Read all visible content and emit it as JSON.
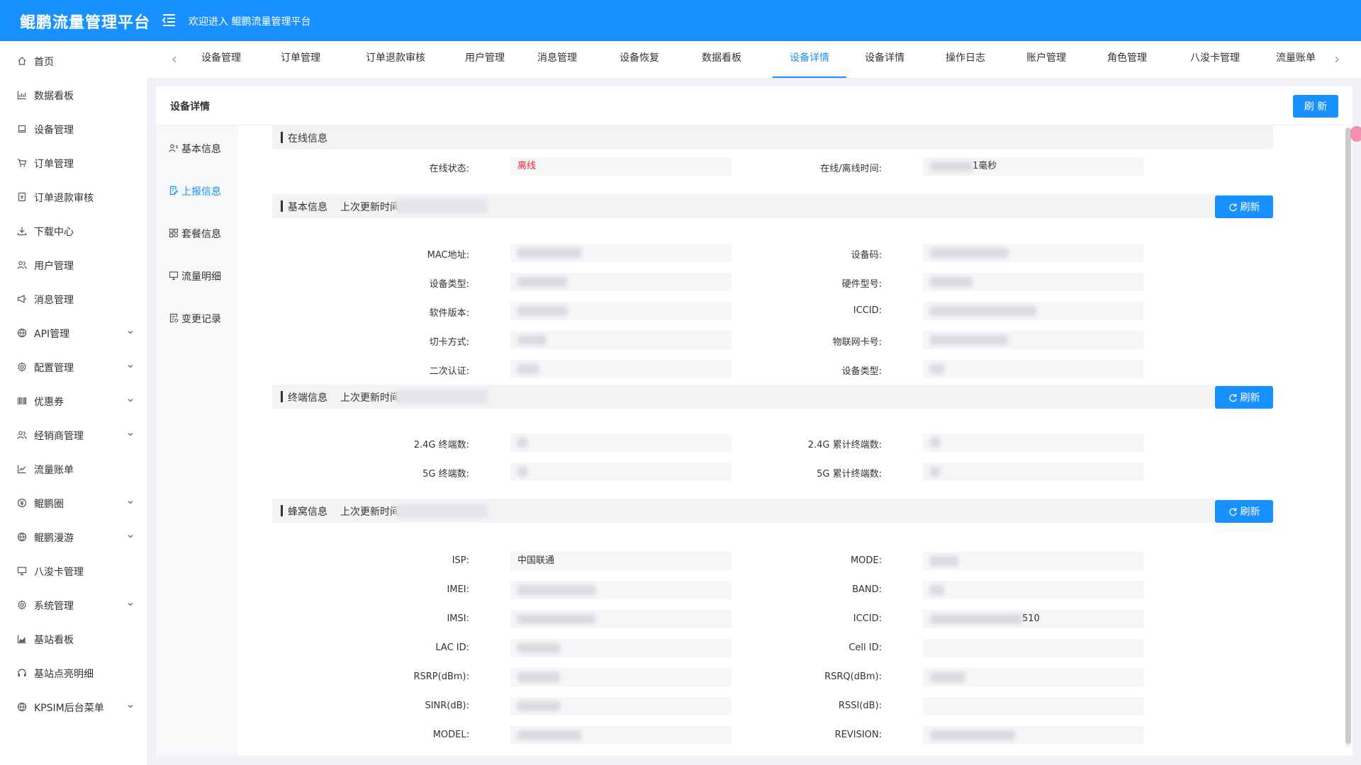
{
  "header": {
    "app_title": "鲲鹏流量管理平台",
    "welcome": "欢迎进入 鲲鹏流量管理平台"
  },
  "sidebar": {
    "items": [
      {
        "label": "首页",
        "icon": "home-icon",
        "expandable": false
      },
      {
        "label": "数据看板",
        "icon": "bar-chart-icon",
        "expandable": false
      },
      {
        "label": "设备管理",
        "icon": "laptop-icon",
        "expandable": false
      },
      {
        "label": "订单管理",
        "icon": "cart-icon",
        "expandable": false
      },
      {
        "label": "订单退款审核",
        "icon": "refund-icon",
        "expandable": false
      },
      {
        "label": "下载中心",
        "icon": "download-icon",
        "expandable": false
      },
      {
        "label": "用户管理",
        "icon": "users-icon",
        "expandable": false
      },
      {
        "label": "消息管理",
        "icon": "megaphone-icon",
        "expandable": false
      },
      {
        "label": "API管理",
        "icon": "globe-icon",
        "expandable": true
      },
      {
        "label": "配置管理",
        "icon": "gear-icon",
        "expandable": true
      },
      {
        "label": "优惠券",
        "icon": "barcode-icon",
        "expandable": true
      },
      {
        "label": "经销商管理",
        "icon": "users-icon",
        "expandable": true
      },
      {
        "label": "流量账单",
        "icon": "line-chart-icon",
        "expandable": false
      },
      {
        "label": "鲲鹏圈",
        "icon": "yen-icon",
        "expandable": true
      },
      {
        "label": "鲲鹏漫游",
        "icon": "globe-icon",
        "expandable": true
      },
      {
        "label": "八浚卡管理",
        "icon": "monitor-icon",
        "expandable": false
      },
      {
        "label": "系统管理",
        "icon": "gear-icon",
        "expandable": true
      },
      {
        "label": "基站看板",
        "icon": "area-chart-icon",
        "expandable": false
      },
      {
        "label": "基站点亮明细",
        "icon": "headset-icon",
        "expandable": false
      },
      {
        "label": "KPSIM后台菜单",
        "icon": "globe-icon",
        "expandable": true
      }
    ]
  },
  "tabs": {
    "items": [
      {
        "label": "设备管理",
        "active": false
      },
      {
        "label": "订单管理",
        "active": false
      },
      {
        "label": "订单退款审核",
        "active": false
      },
      {
        "label": "用户管理",
        "active": false
      },
      {
        "label": "消息管理",
        "active": false
      },
      {
        "label": "设备恢复",
        "active": false
      },
      {
        "label": "数据看板",
        "active": false
      },
      {
        "label": "设备详情",
        "active": true
      },
      {
        "label": "设备详情",
        "active": false
      },
      {
        "label": "操作日志",
        "active": false
      },
      {
        "label": "账户管理",
        "active": false
      },
      {
        "label": "角色管理",
        "active": false
      },
      {
        "label": "八浚卡管理",
        "active": false
      },
      {
        "label": "流量账单",
        "active": false
      }
    ]
  },
  "card": {
    "title": "设备详情",
    "refresh_label": "刷 新"
  },
  "subnav": {
    "items": [
      {
        "label": "基本信息",
        "icon": "user-group-icon",
        "active": false
      },
      {
        "label": "上报信息",
        "icon": "document-edit-icon",
        "active": true
      },
      {
        "label": "套餐信息",
        "icon": "grid-icon",
        "active": false
      },
      {
        "label": "流量明细",
        "icon": "monitor-icon",
        "active": false
      },
      {
        "label": "变更记录",
        "icon": "document-list-icon",
        "active": false
      }
    ]
  },
  "sections": {
    "online": {
      "title": "在线信息",
      "fields": {
        "status_label": "在线状态:",
        "status_value": "离线",
        "status_color": "#f5222d",
        "time_label": "在线/离线时间:",
        "time_value_tail": "1毫秒"
      }
    },
    "basic": {
      "title": "基本信息",
      "time_label": "上次更新时间:",
      "refresh_label": "刷新",
      "left_labels": [
        "MAC地址:",
        "设备类型:",
        "软件版本:",
        "切卡方式:",
        "二次认证:"
      ],
      "right_labels": [
        "设备码:",
        "硬件型号:",
        "ICCID:",
        "物联网卡号:",
        "设备类型:"
      ]
    },
    "terminal": {
      "title": "终端信息",
      "time_label": "上次更新时间:",
      "refresh_label": "刷新",
      "left_labels": [
        "2.4G 终端数:",
        "5G 终端数:"
      ],
      "right_labels": [
        "2.4G 累计终端数:",
        "5G 累计终端数:"
      ]
    },
    "cellular": {
      "title": "蜂窝信息",
      "time_label": "上次更新时间:",
      "refresh_label": "刷新",
      "left_labels": [
        "ISP:",
        "IMEI:",
        "IMSI:",
        "LAC ID:",
        "RSRP(dBm):",
        "SINR(dB):",
        "MODEL:"
      ],
      "right_labels": [
        "MODE:",
        "BAND:",
        "ICCID:",
        "Cell ID:",
        "RSRQ(dBm):",
        "RSSI(dB):",
        "REVISION:"
      ],
      "isp_value": "中国联通",
      "iccid_tail": "510"
    }
  },
  "colors": {
    "primary": "#1890ff",
    "offline_red": "#f5222d",
    "section_bg": "#f2f3f5"
  }
}
